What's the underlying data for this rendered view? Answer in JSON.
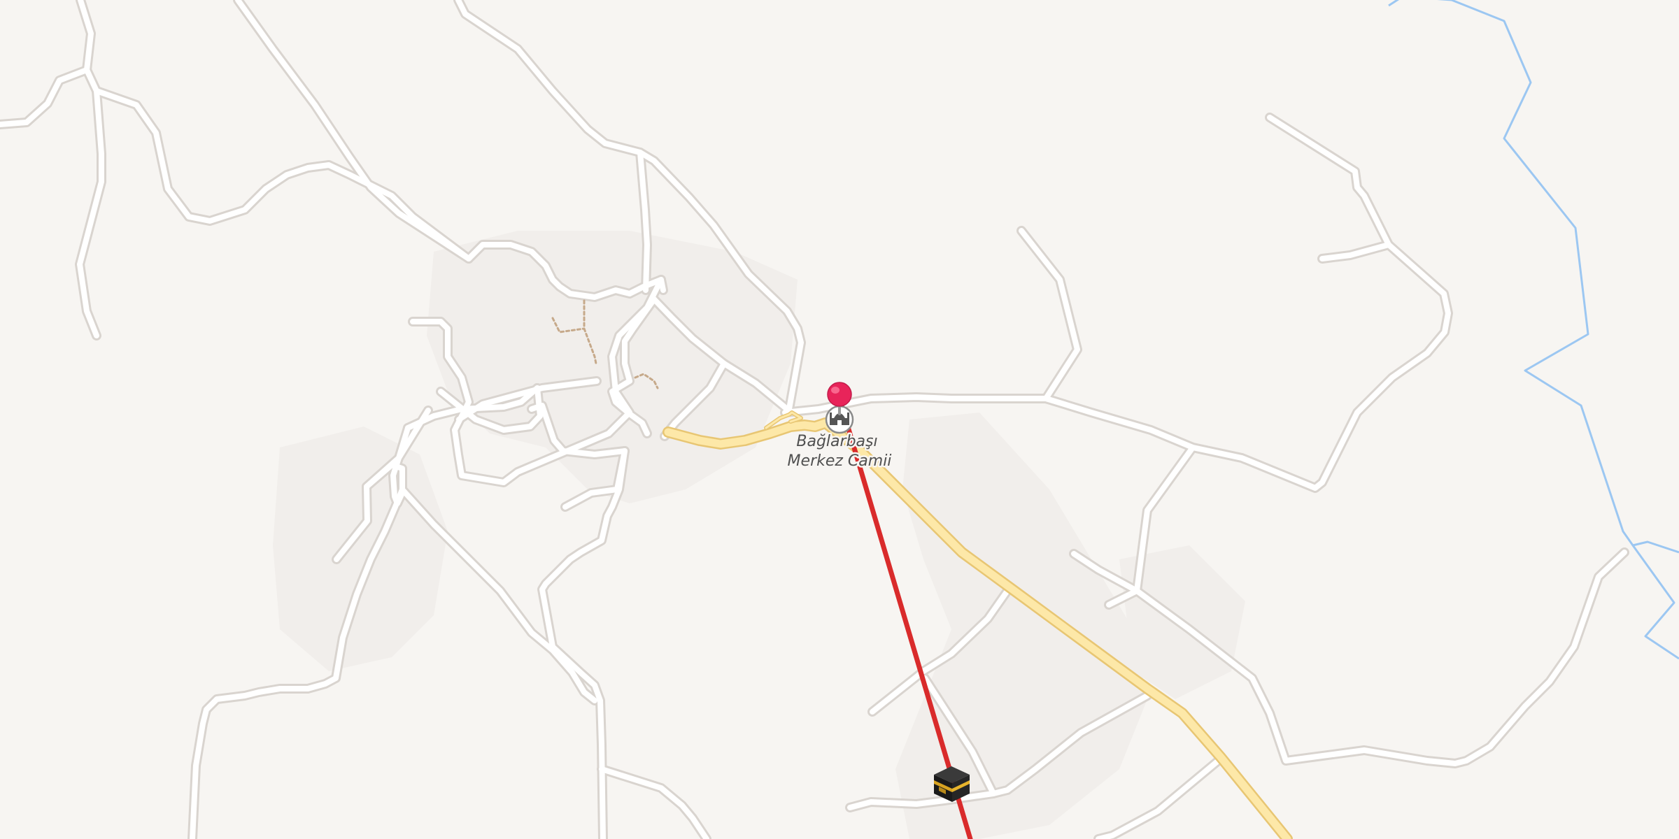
{
  "map": {
    "poi": {
      "name_line1": "Bağlarbaşı",
      "name_line2": "Merkez Camii",
      "icon": "mosque-icon"
    },
    "destination": {
      "icon": "kaaba-icon"
    },
    "marker": {
      "icon": "location-pin-icon",
      "color": "#e8245a"
    },
    "route_color": "#d92b2b",
    "colors": {
      "background": "#f7f5f2",
      "road": "#ffffff",
      "main_road": "#fde8a8",
      "stream": "#9cc7f2"
    }
  }
}
